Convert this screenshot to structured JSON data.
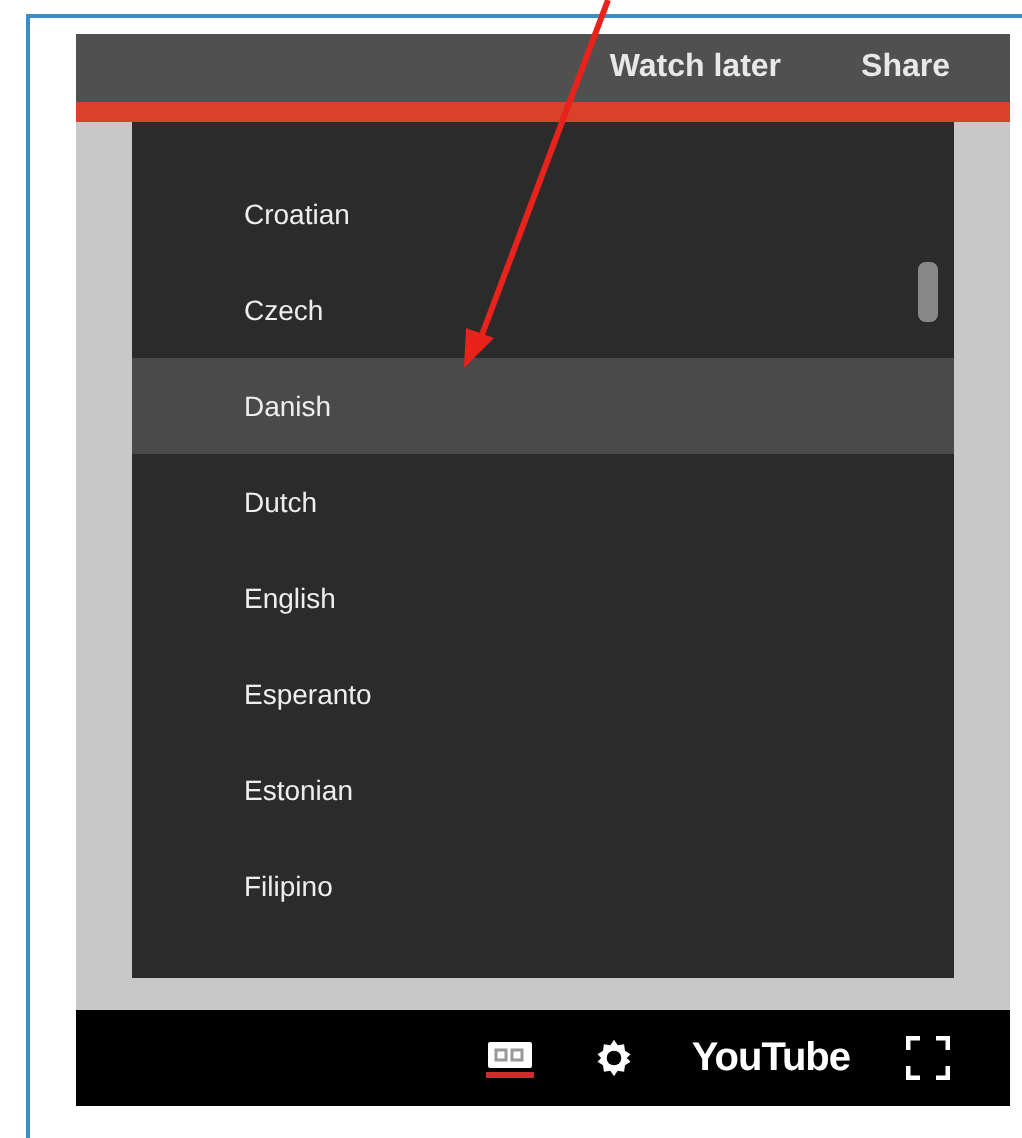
{
  "header": {
    "watch_later": "Watch later",
    "share": "Share"
  },
  "language_menu": {
    "items": [
      {
        "label": "Croatian",
        "selected": false
      },
      {
        "label": "Czech",
        "selected": false
      },
      {
        "label": "Danish",
        "selected": true
      },
      {
        "label": "Dutch",
        "selected": false
      },
      {
        "label": "English",
        "selected": false
      },
      {
        "label": "Esperanto",
        "selected": false
      },
      {
        "label": "Estonian",
        "selected": false
      },
      {
        "label": "Filipino",
        "selected": false
      }
    ]
  },
  "controls": {
    "captions_on": true,
    "brand": "YouTube"
  }
}
